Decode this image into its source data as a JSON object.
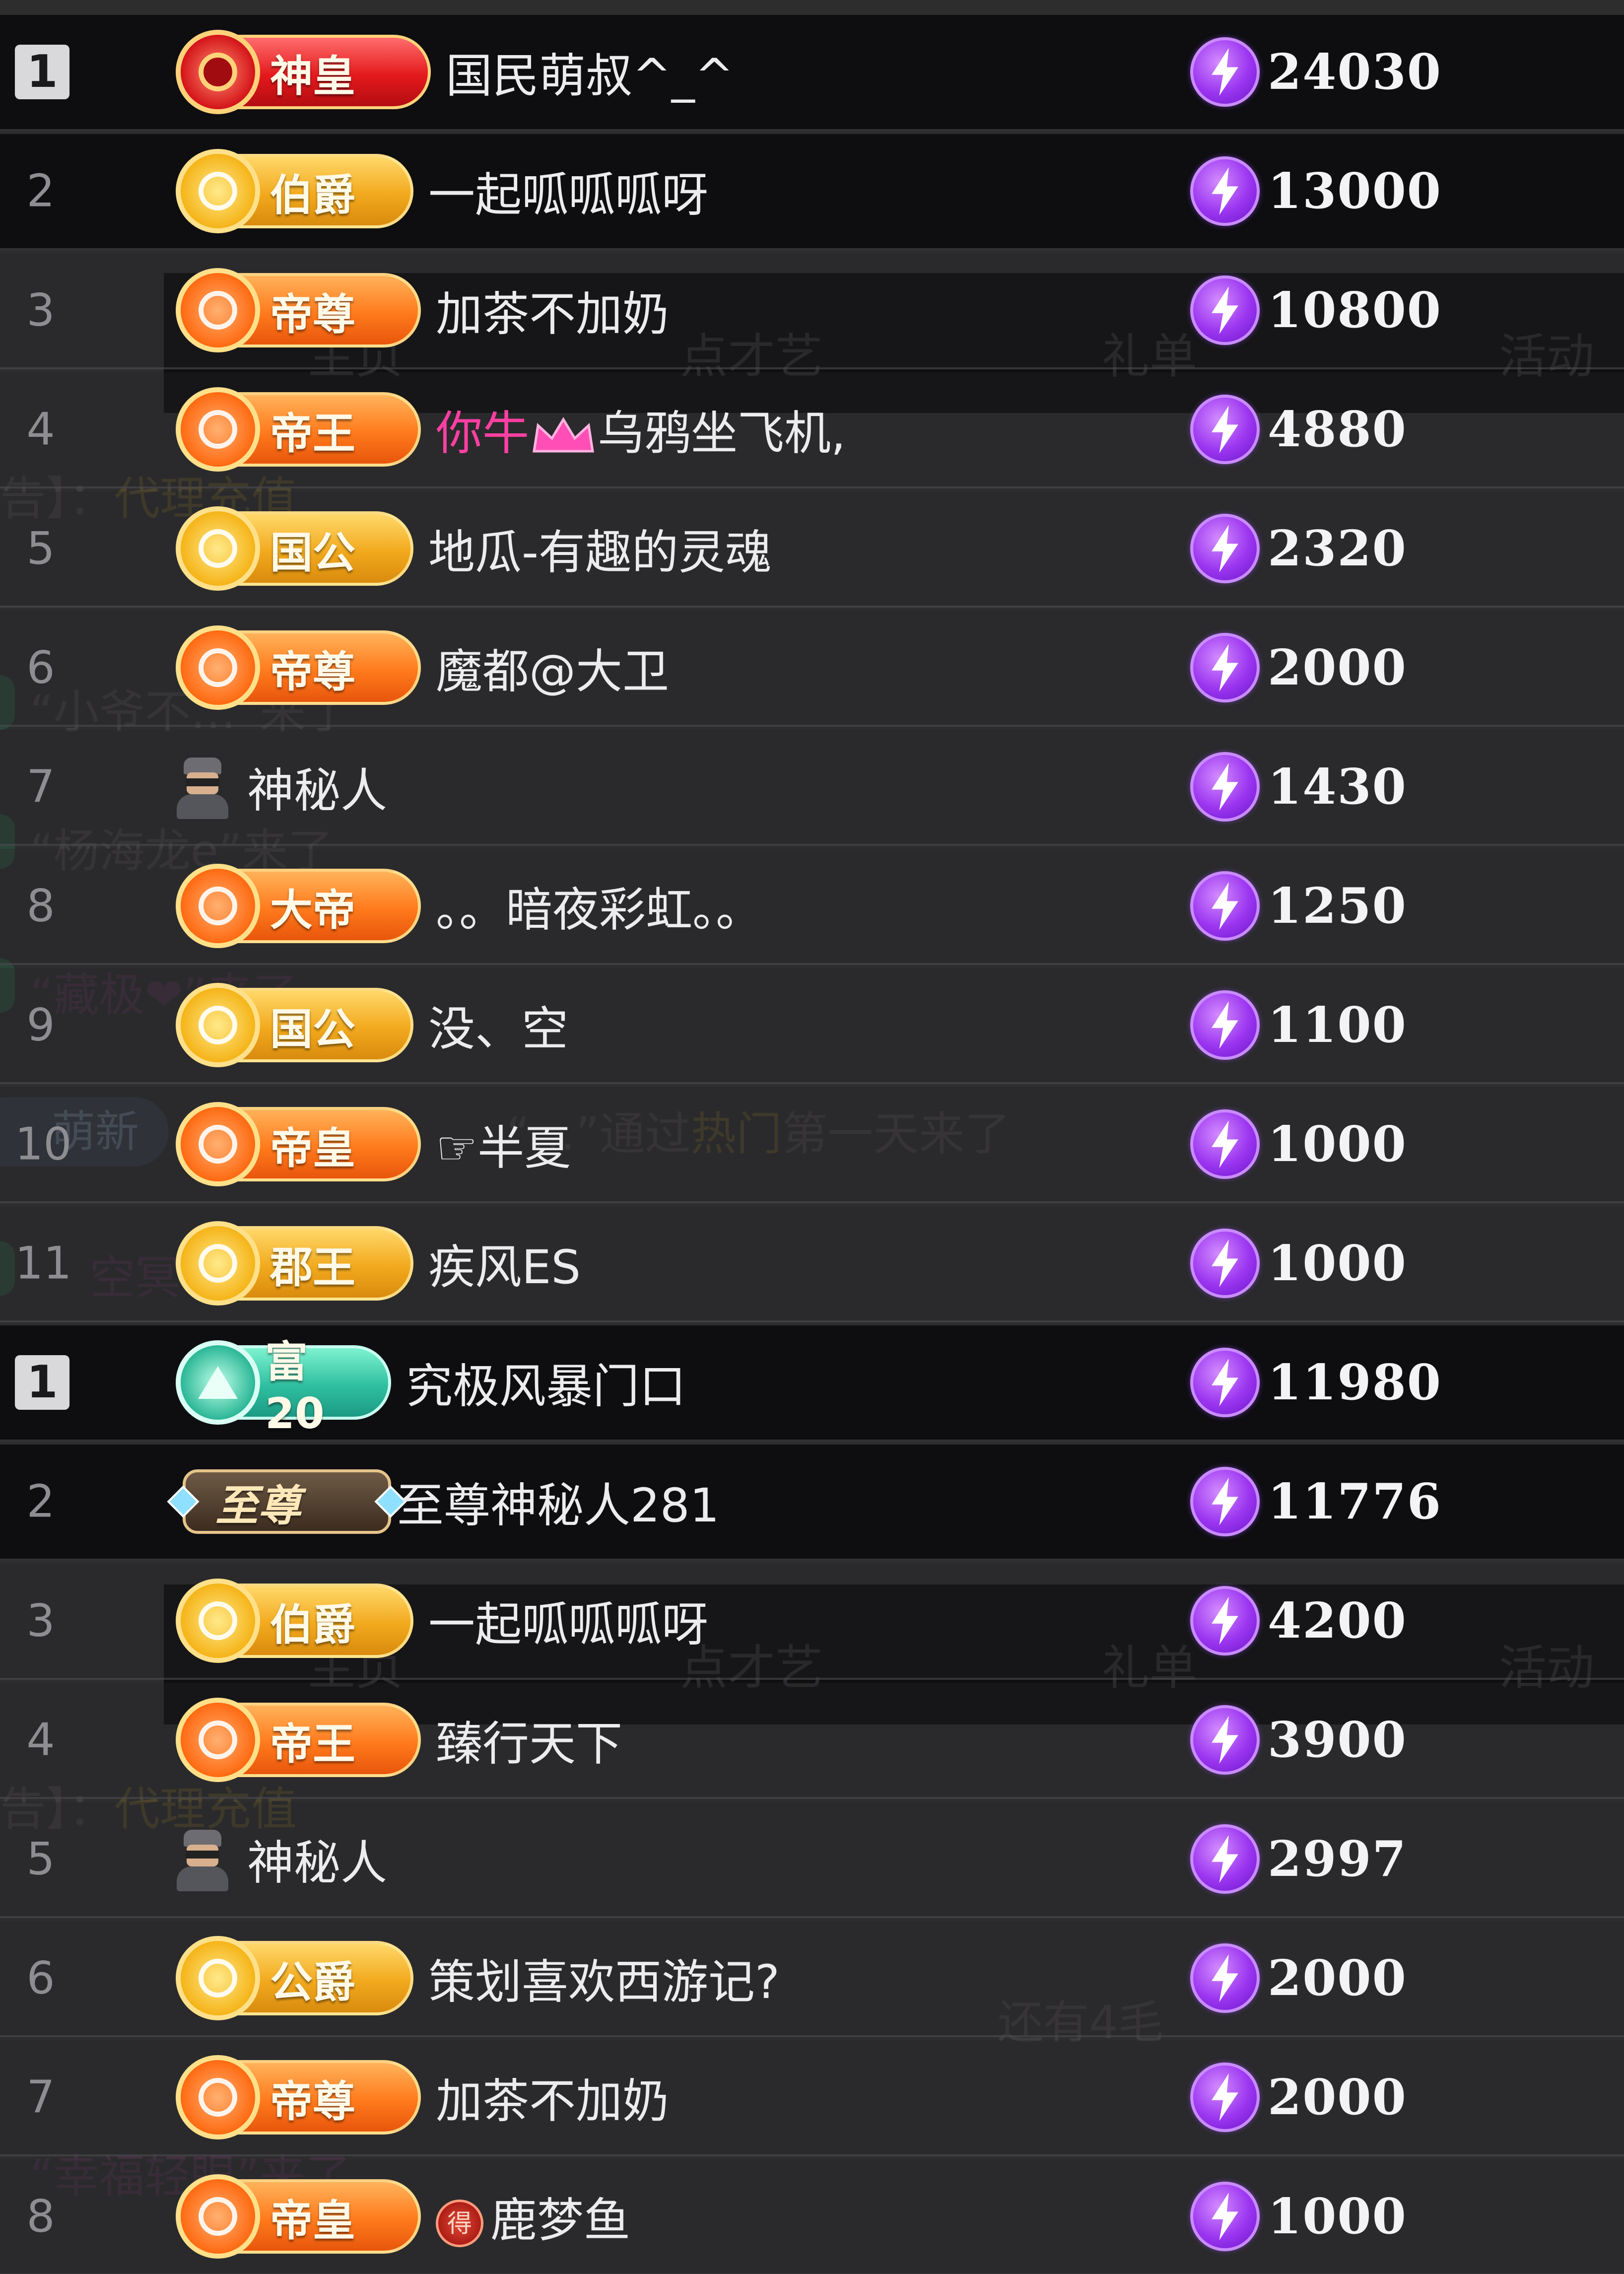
{
  "background": {
    "tabs": [
      "主页",
      "点才艺",
      "礼单",
      "活动"
    ],
    "chat": [
      {
        "pre": "告】：",
        "hl": "代理充值"
      },
      {
        "text": "“小爷不…”来了"
      },
      {
        "text": "“杨海龙e”来了"
      },
      {
        "text": "“藏极❤”来了"
      },
      {
        "pill": "萌新",
        "text": "“…”通过",
        "hl": "热门",
        "post": "第一天来了"
      },
      {
        "text": "空冥"
      },
      {
        "text": "还有4毛"
      },
      {
        "text": "“幸福轻眼”来了"
      }
    ]
  },
  "lists": [
    {
      "rows": [
        {
          "rank": "1",
          "badge": "神皇",
          "badge_style": "red",
          "name": "国民萌叔^_^",
          "amount": "24030"
        },
        {
          "rank": "2",
          "badge": "伯爵",
          "badge_style": "gold",
          "name": "一起呱呱呱呀",
          "amount": "13000"
        },
        {
          "rank": "3",
          "badge": "帝尊",
          "badge_style": "orange",
          "name": "加茶不加奶",
          "amount": "10800"
        },
        {
          "rank": "4",
          "badge": "帝王",
          "badge_style": "orange",
          "name_pink": "你牛",
          "name": "乌鸦坐飞机,",
          "crown": true,
          "amount": "4880"
        },
        {
          "rank": "5",
          "badge": "国公",
          "badge_style": "gold",
          "name": "地瓜-有趣的灵魂",
          "amount": "2320"
        },
        {
          "rank": "6",
          "badge": "帝尊",
          "badge_style": "orange",
          "name": "魔都@大卫",
          "amount": "2000"
        },
        {
          "rank": "7",
          "badge": "",
          "badge_style": "mystery",
          "name": "神秘人",
          "amount": "1430"
        },
        {
          "rank": "8",
          "badge": "大帝",
          "badge_style": "orange",
          "name": "。。暗夜彩虹。。",
          "amount": "1250"
        },
        {
          "rank": "9",
          "badge": "国公",
          "badge_style": "gold",
          "name": "没、空",
          "amount": "1100"
        },
        {
          "rank": "10",
          "badge": "帝皇",
          "badge_style": "orange",
          "name": "☞半夏",
          "amount": "1000"
        },
        {
          "rank": "11",
          "badge": "郡王",
          "badge_style": "gold",
          "name": "疾风ES",
          "amount": "1000"
        }
      ]
    },
    {
      "rows": [
        {
          "rank": "1",
          "badge": "富20",
          "badge_style": "teal",
          "name": "究极风暴门口",
          "amount": "11980"
        },
        {
          "rank": "2",
          "badge": "至尊",
          "badge_style": "zhizun",
          "name": "至尊神秘人281",
          "amount": "11776"
        },
        {
          "rank": "3",
          "badge": "伯爵",
          "badge_style": "gold",
          "name": "一起呱呱呱呀",
          "amount": "4200"
        },
        {
          "rank": "4",
          "badge": "帝王",
          "badge_style": "orange",
          "name": "臻行天下",
          "amount": "3900"
        },
        {
          "rank": "5",
          "badge": "",
          "badge_style": "mystery",
          "name": "神秘人",
          "amount": "2997"
        },
        {
          "rank": "6",
          "badge": "公爵",
          "badge_style": "gold",
          "name": "策划喜欢西游记?",
          "amount": "2000"
        },
        {
          "rank": "7",
          "badge": "帝尊",
          "badge_style": "orange",
          "name": "加茶不加奶",
          "amount": "2000"
        },
        {
          "rank": "8",
          "badge": "帝皇",
          "badge_style": "orange",
          "name": "鹿梦鱼",
          "prefix_coin": "得",
          "amount": "1000"
        }
      ]
    }
  ],
  "colors": {
    "row_dark": "#0e0e11",
    "rank_gray": "#8e8e92",
    "name_text": "#ececee",
    "pink_text": "#ff3fa2",
    "bolt_purple": "#9b35f0"
  },
  "icons": {
    "currency": "purple-lightning-coin-icon",
    "rank_badge": "medal-badge-icon",
    "mystery": "mystery-man-avatar-icon",
    "crown": "pink-crown-icon"
  }
}
